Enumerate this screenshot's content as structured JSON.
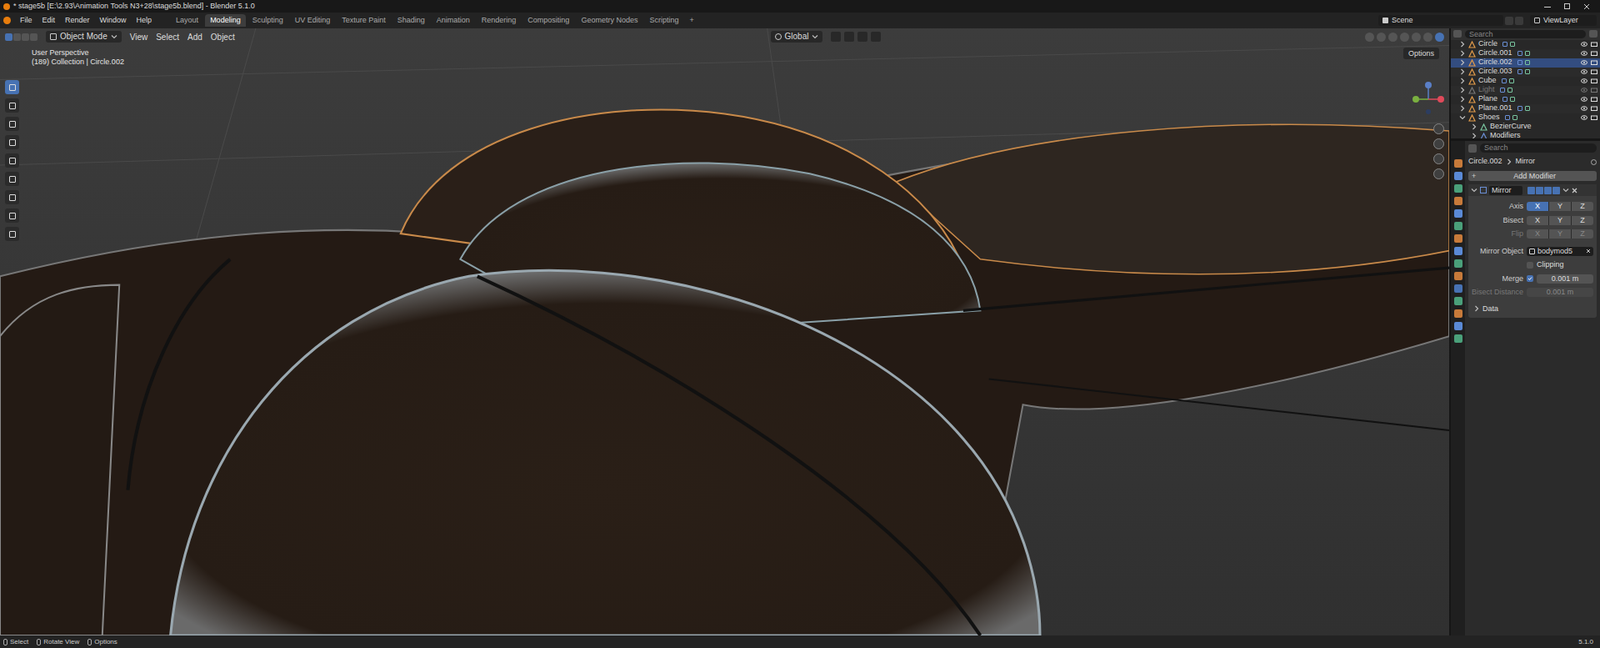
{
  "window": {
    "title": "* stage5b [E:\\2.93\\Animation Tools N3+28\\stage5b.blend] - Blender 5.1.0"
  },
  "menu": [
    "File",
    "Edit",
    "Render",
    "Window",
    "Help"
  ],
  "workspaces": [
    {
      "label": "Layout",
      "selected": false
    },
    {
      "label": "Modeling",
      "selected": true
    },
    {
      "label": "Sculpting",
      "selected": false
    },
    {
      "label": "UV Editing",
      "selected": false
    },
    {
      "label": "Texture Paint",
      "selected": false
    },
    {
      "label": "Shading",
      "selected": false
    },
    {
      "label": "Animation",
      "selected": false
    },
    {
      "label": "Rendering",
      "selected": false
    },
    {
      "label": "Compositing",
      "selected": false
    },
    {
      "label": "Geometry Nodes",
      "selected": false
    },
    {
      "label": "Scripting",
      "selected": false
    }
  ],
  "add_workspace": "+",
  "scene": "Scene",
  "view_layer": "ViewLayer",
  "viewport": {
    "mode": "Object Mode",
    "menus": [
      "View",
      "Select",
      "Add",
      "Object"
    ],
    "orientation": "Global",
    "options": "Options",
    "overlay": [
      "User Perspective",
      "(189) Collection | Circle.002"
    ]
  },
  "outliner": {
    "search": "Search",
    "items": [
      {
        "name": "Circle",
        "kind": "mesh",
        "selected": false,
        "disabled": false,
        "expanded": false,
        "children": []
      },
      {
        "name": "Circle.001",
        "kind": "mesh",
        "selected": false,
        "disabled": false,
        "expanded": false,
        "children": []
      },
      {
        "name": "Circle.002",
        "kind": "mesh",
        "selected": true,
        "disabled": false,
        "expanded": false,
        "children": []
      },
      {
        "name": "Circle.003",
        "kind": "mesh",
        "selected": false,
        "disabled": false,
        "expanded": false,
        "children": []
      },
      {
        "name": "Cube",
        "kind": "mesh",
        "selected": false,
        "disabled": false,
        "expanded": false,
        "children": []
      },
      {
        "name": "Light",
        "kind": "light",
        "selected": false,
        "disabled": true,
        "expanded": false,
        "children": []
      },
      {
        "name": "Plane",
        "kind": "mesh",
        "selected": false,
        "disabled": false,
        "expanded": false,
        "children": []
      },
      {
        "name": "Plane.001",
        "kind": "mesh",
        "selected": false,
        "disabled": false,
        "expanded": false,
        "children": []
      },
      {
        "name": "Shoes",
        "kind": "mesh",
        "selected": false,
        "disabled": false,
        "expanded": true,
        "children": [
          {
            "name": "BezierCurve",
            "kind": "curve",
            "selected": false,
            "disabled": false
          },
          {
            "name": "Modifiers",
            "kind": "modifiers",
            "selected": false,
            "disabled": false
          }
        ]
      }
    ]
  },
  "properties": {
    "search": "Search",
    "breadcrumb": [
      "Circle.002",
      "Mirror"
    ],
    "add_modifier": "Add Modifier",
    "modifier": {
      "name": "Mirror",
      "expanded": true,
      "axis": {
        "label": "Axis",
        "disabled": false,
        "options": [
          {
            "label": "X",
            "selected": true
          },
          {
            "label": "Y",
            "selected": false
          },
          {
            "label": "Z",
            "selected": false
          }
        ]
      },
      "bisect": {
        "label": "Bisect",
        "disabled": false,
        "options": [
          {
            "label": "X",
            "selected": false
          },
          {
            "label": "Y",
            "selected": false
          },
          {
            "label": "Z",
            "selected": false
          }
        ]
      },
      "flip": {
        "label": "Flip",
        "disabled": true,
        "options": [
          {
            "label": "X",
            "selected": false
          },
          {
            "label": "Y",
            "selected": false
          },
          {
            "label": "Z",
            "selected": false
          }
        ]
      },
      "mirror_object": {
        "label": "Mirror Object",
        "value": "bodymod5"
      },
      "clipping": {
        "label": "Clipping",
        "checked": false
      },
      "merge": {
        "label": "Merge",
        "checked": true,
        "value": "0.001 m"
      },
      "bisect_distance": {
        "label": "Bisect Distance",
        "value": "0.001 m",
        "disabled": true
      },
      "data": {
        "label": "Data",
        "expanded": false
      }
    }
  },
  "status_bar": {
    "items": [
      "Select",
      "Rotate View",
      "Options"
    ],
    "version": "5.1.0"
  }
}
